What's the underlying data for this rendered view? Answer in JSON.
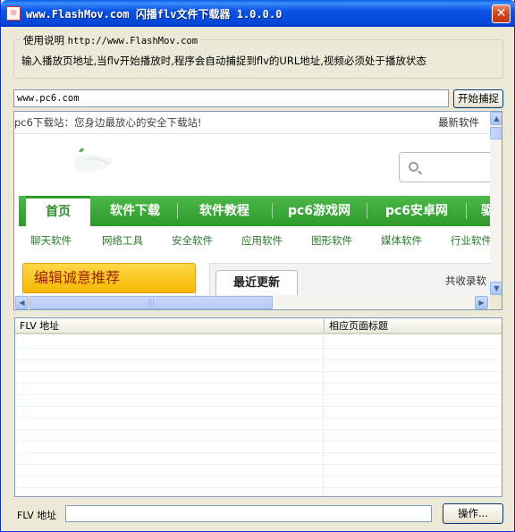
{
  "window": {
    "title": "www.FlashMov.com 闪播flv文件下载器 1.0.0.0",
    "app_icon": "app-icon",
    "close_label": "✕"
  },
  "usage": {
    "legend_label": "使用说明",
    "legend_url": "http://www.FlashMov.com",
    "description": "输入播放页地址,当flv开始播放时,程序会自动捕捉到flv的URL地址,视频必须处于播放状态"
  },
  "url_bar": {
    "value": "www.pc6.com",
    "capture_button": "开始捕捉"
  },
  "browser": {
    "top_line": "pc6下载站：您身边最放心的安全下载站!",
    "top_right": "最新软件",
    "nav": [
      "首页",
      "软件下载",
      "软件教程",
      "pc6游戏网",
      "pc6安卓网",
      "驱"
    ],
    "subnav": [
      "聊天软件",
      "网络工具",
      "安全软件",
      "应用软件",
      "图形软件",
      "媒体软件",
      "行业软件"
    ],
    "recommend": "编辑诚意推荐",
    "recent_tab": "最近更新",
    "recent_count": "共收录软",
    "colors": {
      "nav_green": "#3aa838",
      "recommend_yellow": "#f7c21a"
    }
  },
  "list": {
    "columns": [
      "FLV 地址",
      "相应页面标题"
    ],
    "rows": []
  },
  "footer": {
    "flv_label": "FLV 地址",
    "flv_value": "",
    "op_button": "操作..."
  }
}
